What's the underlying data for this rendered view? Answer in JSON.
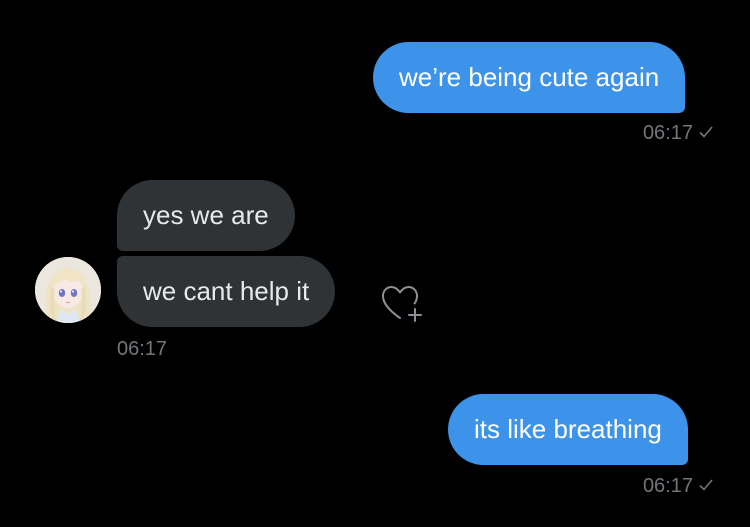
{
  "messages": {
    "m1": {
      "text": "we’re being cute again",
      "time": "06:17"
    },
    "m2": {
      "text": "yes we are"
    },
    "m3": {
      "text": "we cant help it",
      "time": "06:17"
    },
    "m4": {
      "text": "its like breathing",
      "time": "06:17"
    }
  },
  "icons": {
    "read_receipt": "checkmark-icon",
    "reaction": "heart-plus-icon",
    "avatar": "anime-doll-avatar"
  },
  "colors": {
    "background": "#000000",
    "outgoing_bubble": "#3d93e9",
    "incoming_bubble": "#2f3336",
    "timestamp": "#71767b"
  }
}
